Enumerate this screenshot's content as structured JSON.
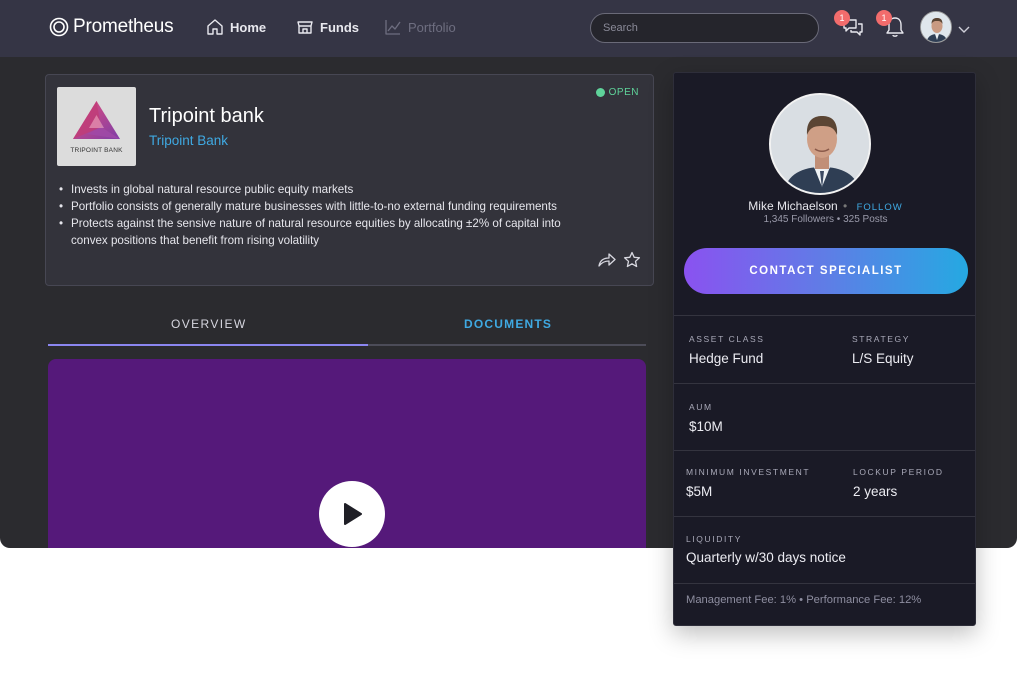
{
  "app": {
    "name": "Prometheus"
  },
  "nav": {
    "home": "Home",
    "funds": "Funds",
    "portfolio": "Portfolio"
  },
  "search": {
    "placeholder": "Search"
  },
  "notifications": {
    "messages_count": "1",
    "alerts_count": "1"
  },
  "fund": {
    "logo_text": "TRIPOINT BANK",
    "title": "Tripoint bank",
    "subtitle": "Tripoint Bank",
    "status": "OPEN",
    "bullets": [
      "Invests in global natural resource public equity markets",
      "Portfolio consists of generally mature businesses with little-to-no external funding requirements",
      "Protects against the sensive nature of natural resource equities by allocating ±2% of capital into convex positions that benefit from rising volatility"
    ]
  },
  "tabs": {
    "overview": "OVERVIEW",
    "documents": "DOCUMENTS"
  },
  "specialist": {
    "name": "Mike Michaelson",
    "follow": "FOLLOW",
    "stats": "1,345 Followers • 325 Posts",
    "contact_label": "CONTACT SPECIALIST"
  },
  "details": {
    "asset_class_label": "ASSET CLASS",
    "asset_class": "Hedge Fund",
    "strategy_label": "STRATEGY",
    "strategy": "L/S Equity",
    "aum_label": "AUM",
    "aum": "$10M",
    "min_investment_label": "MINIMUM INVESTMENT",
    "min_investment": "$5M",
    "lockup_label": "LOCKUP PERIOD",
    "lockup": "2 years",
    "liquidity_label": "LIQUIDITY",
    "liquidity": "Quarterly w/30 days notice",
    "fees": "Management Fee: 1% • Performance Fee: 12%"
  },
  "colors": {
    "accent_blue": "#3fa9e2",
    "open_green": "#5fd39a",
    "badge_red": "#f26c6c",
    "video_purple": "#55197a"
  }
}
